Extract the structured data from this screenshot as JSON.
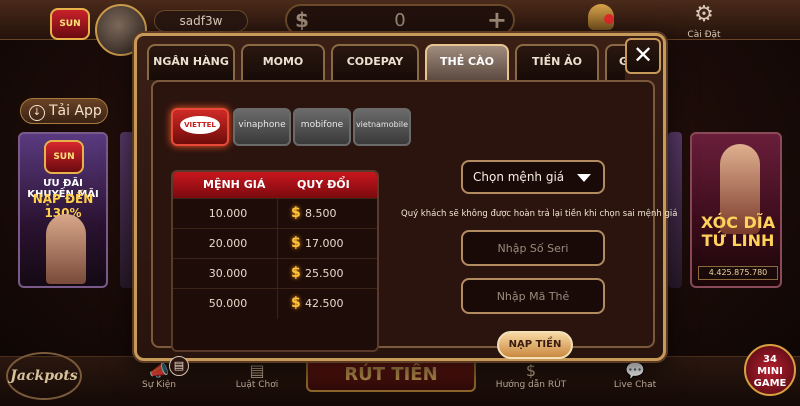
{
  "topbar": {
    "logo_text": "SUN",
    "username": "sadf3w",
    "balance": "0",
    "dollar_sign": "$",
    "plus_sign": "+",
    "settings_label": "Cài Đặt"
  },
  "side": {
    "tai_app_label": "Tải App",
    "promo_line1": "ƯU ĐÃI KHUYẾN MÃI",
    "promo_line2": "NẠP ĐẾN 130%",
    "game_name": "XÓC DĨA TỨ LINH",
    "game_jackpot": "4.425.875.780"
  },
  "bottom_nav": {
    "jackpots": "Jackpots",
    "su_kien": "Sự Kiện",
    "luat_choi": "Luật Chơi",
    "rut_tien": "RÚT TIỀN",
    "huong_dan_rut": "Hướng dẫn RÚT",
    "live_chat": "Live Chat",
    "minigame_count": "34",
    "minigame_label": "MINI GAME"
  },
  "modal": {
    "tabs": [
      {
        "label": "NGÂN HÀNG"
      },
      {
        "label": "MOMO"
      },
      {
        "label": "CODEPAY"
      },
      {
        "label": "THẺ CÀO"
      },
      {
        "label": "TIỀN ẢO"
      },
      {
        "label": "GI"
      }
    ],
    "active_tab_index": 3,
    "close_symbol": "✕",
    "carriers": [
      {
        "name": "VIETTEL",
        "active": true
      },
      {
        "name": "vinaphone",
        "active": false
      },
      {
        "name": "mobifone",
        "active": false
      },
      {
        "name": "vietnamobile",
        "active": false
      }
    ],
    "table": {
      "header_menh_gia": "MỆNH GIÁ",
      "header_quy_doi": "QUY ĐỔI",
      "currency_symbol": "$",
      "rows": [
        {
          "menh_gia": "10.000",
          "quy_doi": "8.500"
        },
        {
          "menh_gia": "20.000",
          "quy_doi": "17.000"
        },
        {
          "menh_gia": "30.000",
          "quy_doi": "25.500"
        },
        {
          "menh_gia": "50.000",
          "quy_doi": "42.500"
        }
      ]
    },
    "select_label": "Chọn mệnh giá",
    "warning": "Quý khách sẽ không được hoàn trả lại tiền khi chọn sai mệnh giá",
    "serial_placeholder": "Nhập Số Seri",
    "card_code_placeholder": "Nhập Mã Thẻ",
    "submit_label": "NẠP TIỀN"
  },
  "colors": {
    "accent_gold": "#c89a5a",
    "active_red": "#c8161e",
    "coin_gold": "#ffc53a"
  }
}
